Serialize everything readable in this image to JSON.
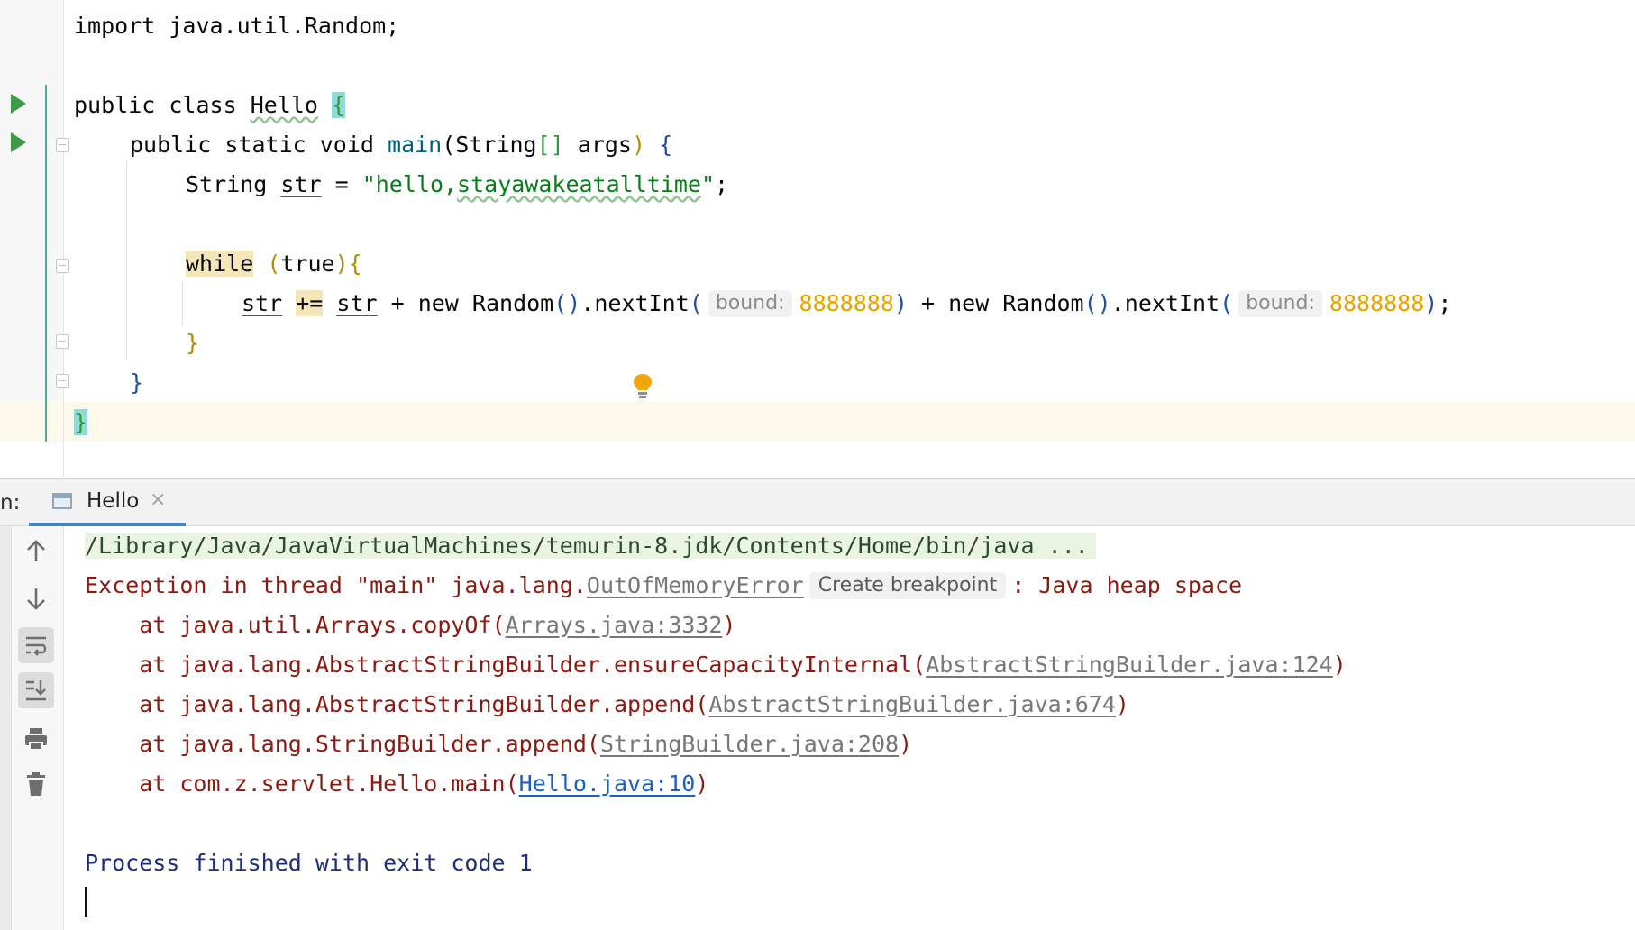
{
  "editor": {
    "lines": {
      "l1": {
        "t1": "import",
        "t2": " java.util.Random;"
      },
      "l3": {
        "t1": "public",
        "t2": " ",
        "t3": "class",
        "t4": " ",
        "t5": "Hello",
        "t6": " ",
        "t7": "{"
      },
      "l4": {
        "t1": "public",
        "t2": " ",
        "t3": "static",
        "t4": " ",
        "t5": "void",
        "t6": " ",
        "t7": "main",
        "t8": "(String",
        "t9": "[]",
        "t10": " args",
        "t11": ")",
        "t12": " ",
        "t13": "{"
      },
      "l5": {
        "t1": "String",
        "t2": " ",
        "t3": "str",
        "t4": " = ",
        "t5": "\"hello,",
        "t6": "stayawakeatalltime",
        "t7": "\"",
        "t8": ";"
      },
      "l7": {
        "t1": "while",
        "t2": " ",
        "t3": "(",
        "t4": "true",
        "t5": ")",
        "t6": "{"
      },
      "l8": {
        "t1": "str",
        "t2": " ",
        "t3": "+=",
        "t4": " ",
        "t5": "str",
        "t6": " + ",
        "t7": "new",
        "t8": " Random",
        "t9": "()",
        "t10": ".nextInt",
        "t11": "(",
        "hint1": "bound:",
        "n1": "8888888",
        "t12": ")",
        "t13": " + ",
        "t14": "new",
        "t15": " Random",
        "t16": "()",
        "t17": ".nextInt",
        "t18": "(",
        "hint2": "bound:",
        "n2": "8888888",
        "t19": ")",
        "t20": ";"
      },
      "l9": {
        "t1": "}"
      },
      "l10": {
        "t1": "}"
      },
      "l11": {
        "t1": "}"
      }
    },
    "icons": {
      "run": "run-triangle-icon",
      "fold": "fold-marker-icon",
      "bulb": "intention-bulb-icon"
    },
    "colors": {
      "keyword": "#0033b3",
      "string": "#067d17",
      "hint_number": "#e5a300",
      "run_icon": "#3d9a46",
      "error": "#8b1a10"
    }
  },
  "run_window": {
    "prefix": "n:",
    "tab": {
      "label": "Hello",
      "close": "×"
    },
    "toolbar": [
      "up-arrow-icon",
      "down-arrow-icon",
      "soft-wrap-icon",
      "scroll-to-end-icon",
      "print-icon",
      "trash-icon"
    ],
    "console": {
      "cmd": "/Library/Java/JavaVirtualMachines/temurin-8.jdk/Contents/Home/bin/java ...",
      "exc": {
        "prefix": "Exception in thread \"main\" java.lang.",
        "link": "OutOfMemoryError",
        "hint": "Create breakpoint",
        "suffix": ": Java heap space"
      },
      "stack": [
        {
          "pre": "    at java.util.Arrays.copyOf(",
          "link": "Arrays.java:3332",
          "post": ")"
        },
        {
          "pre": "    at java.lang.AbstractStringBuilder.ensureCapacityInternal(",
          "link": "AbstractStringBuilder.java:124",
          "post": ")"
        },
        {
          "pre": "    at java.lang.AbstractStringBuilder.append(",
          "link": "AbstractStringBuilder.java:674",
          "post": ")"
        },
        {
          "pre": "    at java.lang.StringBuilder.append(",
          "link": "StringBuilder.java:208",
          "post": ")"
        },
        {
          "pre": "    at com.z.servlet.Hello.main(",
          "link": "Hello.java:10",
          "post": ")"
        }
      ],
      "exit": "Process finished with exit code 1"
    }
  }
}
